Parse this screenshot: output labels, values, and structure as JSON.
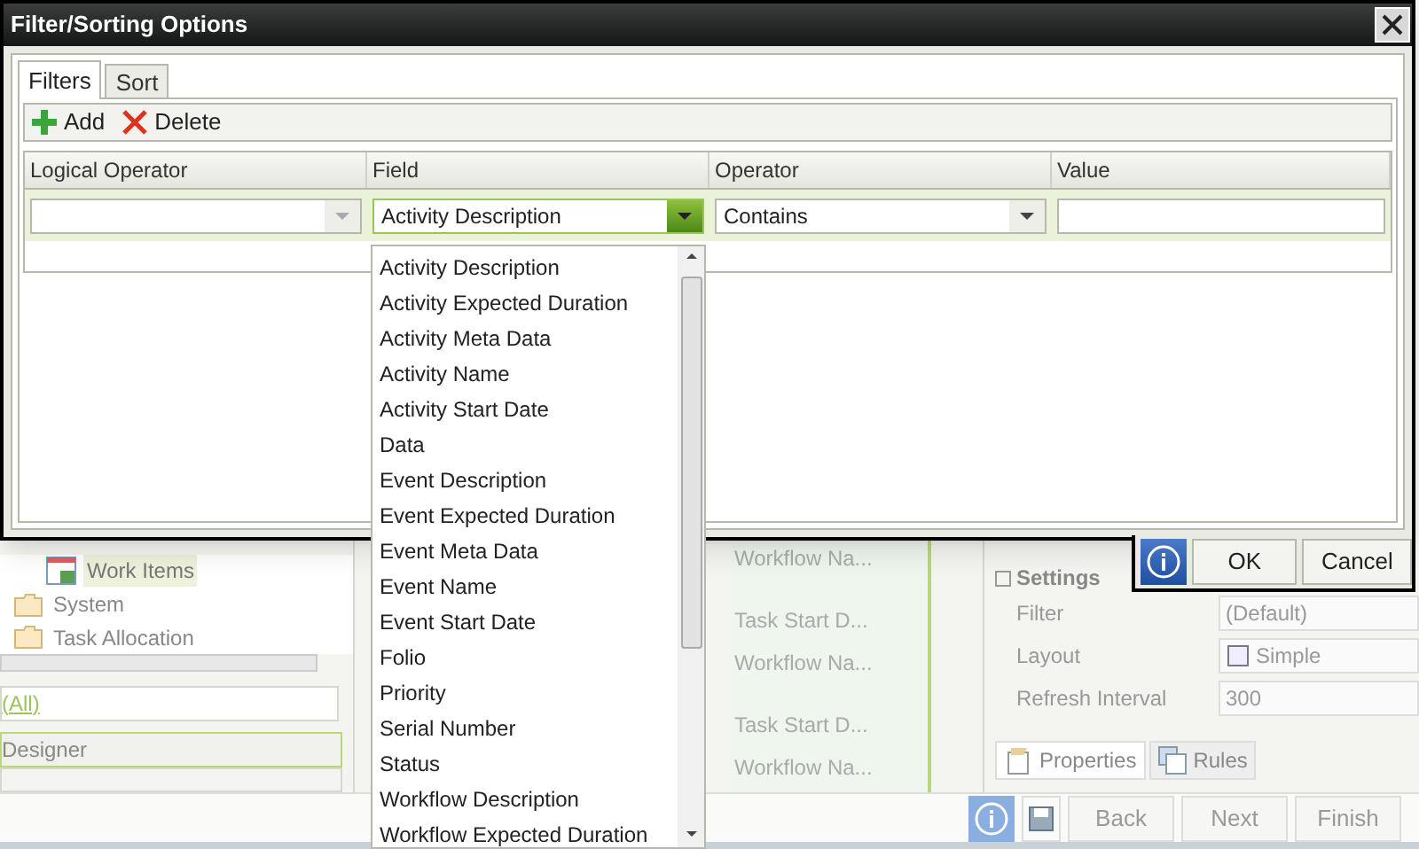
{
  "dialog": {
    "title": "Filter/Sorting Options",
    "tabs": [
      {
        "label": "Filters",
        "selected": true
      },
      {
        "label": "Sort",
        "selected": false
      }
    ],
    "toolbar": [
      {
        "kind": "add",
        "label": "Add"
      },
      {
        "kind": "delete",
        "label": "Delete"
      }
    ],
    "columns": [
      "Logical Operator",
      "Field",
      "Operator",
      "Value"
    ],
    "filter_row": {
      "field": "Activity Description",
      "operator": "Contains"
    },
    "field_options": [
      "Activity Description",
      "Activity Expected Duration",
      "Activity Meta Data",
      "Activity Name",
      "Activity Start Date",
      "Data",
      "Event Description",
      "Event Expected Duration",
      "Event Meta Data",
      "Event Name",
      "Event Start Date",
      "Folio",
      "Priority",
      "Serial Number",
      "Status",
      "Workflow Description",
      "Workflow Expected Duration"
    ],
    "footer_buttons": [
      "OK",
      "Cancel"
    ]
  },
  "background": {
    "tree": [
      {
        "kind": "view",
        "label": "Work Items",
        "selected": true
      },
      {
        "kind": "folder",
        "label": "System",
        "selected": false
      },
      {
        "kind": "folder",
        "label": "Task Allocation",
        "selected": false
      }
    ],
    "filter_link": "(All)",
    "designer_bar": "Designer",
    "list_items": [
      "Workflow Na...",
      "Task Start D...",
      "Workflow Na...",
      "Task Start D...",
      "Workflow Na..."
    ],
    "settings": {
      "title": "Settings",
      "properties": [
        {
          "kind": "text",
          "label": "Filter",
          "value": "(Default)"
        },
        {
          "kind": "layout",
          "label": "Layout",
          "value": "Simple"
        },
        {
          "kind": "text",
          "label": "Refresh Interval",
          "value": "300"
        }
      ]
    },
    "panel_tabs": [
      {
        "kind": "properties",
        "label": "Properties",
        "selected": true
      },
      {
        "kind": "rules",
        "label": "Rules",
        "selected": false
      }
    ],
    "wizard_buttons": [
      "Back",
      "Next",
      "Finish"
    ]
  }
}
